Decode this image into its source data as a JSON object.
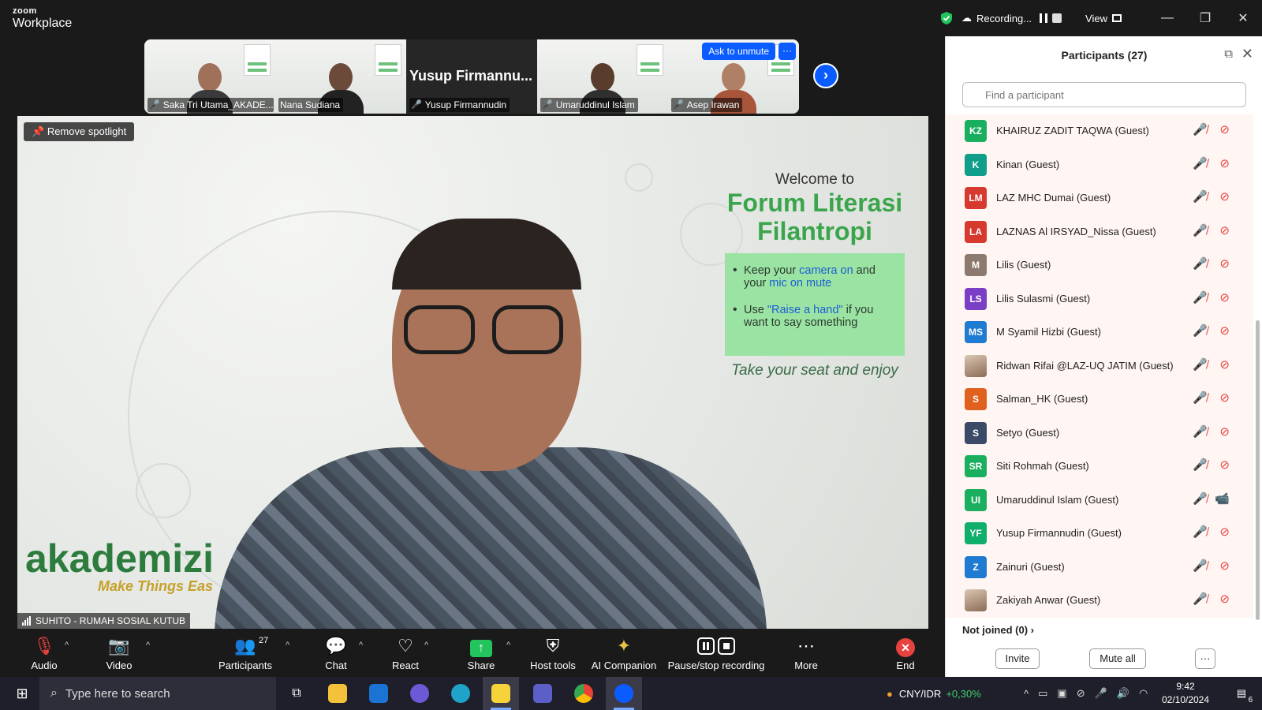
{
  "titlebar": {
    "brand_top": "zoom",
    "brand_bottom": "Workplace",
    "recording_label": "Recording...",
    "view_label": "View"
  },
  "thumbnails": [
    {
      "name": "Saka Tri Utama_AKADE...",
      "muted": true
    },
    {
      "name": "Nana Sudiana",
      "muted": false
    },
    {
      "name": "Yusup Firmannudin",
      "muted": true,
      "display_text": "Yusup Firmannu..."
    },
    {
      "name": "Umaruddinul Islam",
      "muted": true
    },
    {
      "name": "Asep Irawan",
      "muted": true,
      "hover_button": "Ask to unmute",
      "hover_more": "···"
    }
  ],
  "main": {
    "spotlight_button": "Remove spotlight",
    "speaker_name": "SUHITO - RUMAH SOSIAL KUTUB",
    "poster": {
      "welcome": "Welcome to",
      "title_line1": "Forum Literasi",
      "title_line2": "Filantropi",
      "bullet1_a": "Keep your ",
      "bullet1_hl1": "camera on",
      "bullet1_b": " and your ",
      "bullet1_hl2": "mic on mute",
      "bullet2_a": "Use ",
      "bullet2_hl": "\"Raise a hand\"",
      "bullet2_b": " if you want to say something",
      "tagline": "Take your seat and enjoy"
    },
    "logo_text": "akademizi",
    "logo_slogan": "Make Things Eas"
  },
  "toolbar": {
    "audio": "Audio",
    "video": "Video",
    "participants": "Participants",
    "participant_count": "27",
    "chat": "Chat",
    "react": "React",
    "share": "Share",
    "host_tools": "Host tools",
    "ai_companion": "AI Companion",
    "pause_stop": "Pause/stop recording",
    "more": "More",
    "end": "End"
  },
  "panel": {
    "title": "Participants (27)",
    "search_placeholder": "Find a participant",
    "participants": [
      {
        "initials": "KZ",
        "name": "KHAIRUZ ZADIT TAQWA (Guest)",
        "color": "#1aae5f",
        "photo": false,
        "cam_on": false
      },
      {
        "initials": "K",
        "name": "Kinan (Guest)",
        "color": "#0f9e8a",
        "photo": false,
        "cam_on": false
      },
      {
        "initials": "LM",
        "name": "LAZ MHC Dumai (Guest)",
        "color": "#d63a2f",
        "photo": false,
        "cam_on": false
      },
      {
        "initials": "LA",
        "name": "LAZNAS Al IRSYAD_Nissa (Guest)",
        "color": "#d63a2f",
        "photo": false,
        "cam_on": false
      },
      {
        "initials": "M",
        "name": "Lilis (Guest)",
        "color": "#8d7a6e",
        "photo": false,
        "cam_on": false
      },
      {
        "initials": "LS",
        "name": "Lilis Sulasmi (Guest)",
        "color": "#7b3fc7",
        "photo": false,
        "cam_on": false
      },
      {
        "initials": "MS",
        "name": "M Syamil Hizbi (Guest)",
        "color": "#1f7ad1",
        "photo": false,
        "cam_on": false
      },
      {
        "initials": "",
        "name": "Ridwan Rifai @LAZ-UQ JATIM (Guest)",
        "color": "#9aa3ad",
        "photo": true,
        "cam_on": false
      },
      {
        "initials": "S",
        "name": "Salman_HK (Guest)",
        "color": "#e0601d",
        "photo": false,
        "cam_on": false
      },
      {
        "initials": "S",
        "name": "Setyo (Guest)",
        "color": "#3b4a66",
        "photo": false,
        "cam_on": false
      },
      {
        "initials": "SR",
        "name": "Siti Rohmah (Guest)",
        "color": "#1aae5f",
        "photo": false,
        "cam_on": false
      },
      {
        "initials": "UI",
        "name": "Umaruddinul Islam (Guest)",
        "color": "#1aae5f",
        "photo": false,
        "cam_on": true
      },
      {
        "initials": "YF",
        "name": "Yusup Firmannudin (Guest)",
        "color": "#0fae6a",
        "photo": false,
        "cam_on": false
      },
      {
        "initials": "Z",
        "name": "Zainuri (Guest)",
        "color": "#1f7ad1",
        "photo": false,
        "cam_on": false
      },
      {
        "initials": "",
        "name": "Zakiyah Anwar (Guest)",
        "color": "#c7a38a",
        "photo": true,
        "cam_on": false
      }
    ],
    "not_joined": "Not joined (0)",
    "invite": "Invite",
    "mute_all": "Mute all",
    "more": "···"
  },
  "taskbar": {
    "search_placeholder": "Type here to search",
    "currency": "CNY/IDR",
    "currency_change": "+0,30%",
    "time": "9:42",
    "date": "02/10/2024",
    "notifications": "6"
  },
  "colors": {
    "accent": "#0b5cff",
    "muted_red": "#e8423f",
    "share_green": "#23c45e",
    "currency_green": "#3ecf6a"
  }
}
